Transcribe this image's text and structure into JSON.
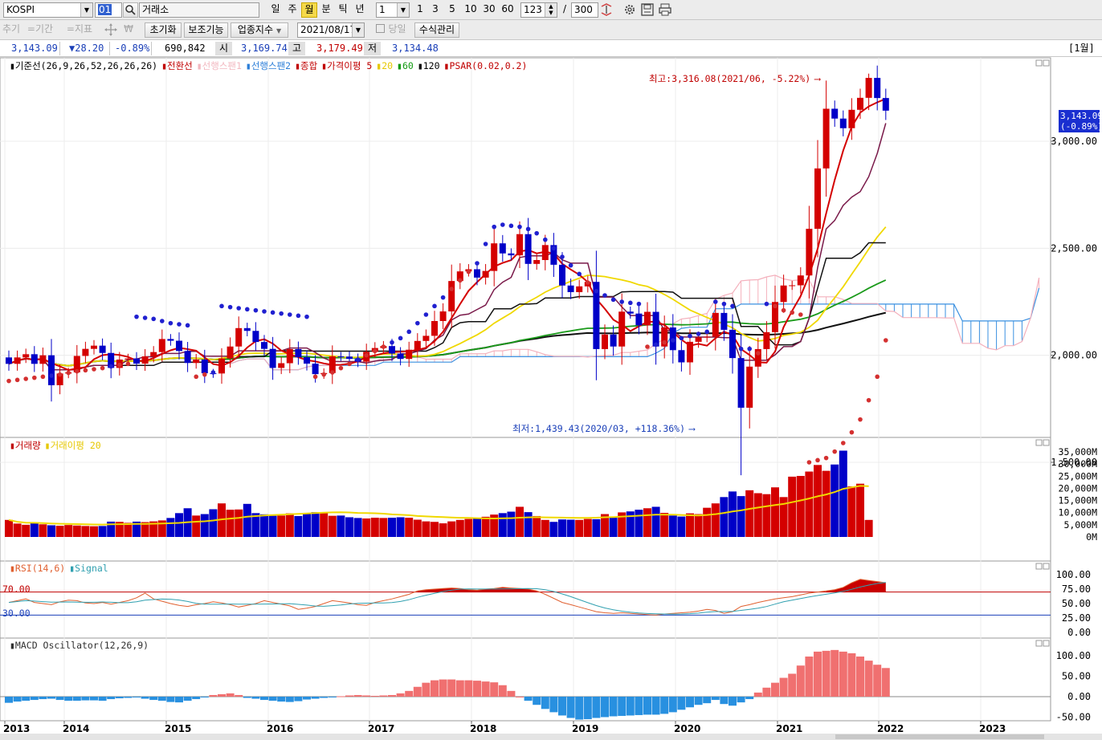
{
  "toolbar": {
    "symbol": "KOSPI",
    "code": "01",
    "exchange": "거래소",
    "periods": [
      "일",
      "주",
      "월",
      "분",
      "틱",
      "년"
    ],
    "active_period": "월",
    "multiplier": "1",
    "quick_nums": [
      "1",
      "3",
      "5",
      "10",
      "30",
      "60"
    ],
    "visible_bars": "123",
    "slash": "/",
    "total_bars": "300"
  },
  "toolbar2": {
    "disabled": [
      "추기",
      "=기간",
      "=지표"
    ],
    "buttons": [
      "초기화",
      "보조기능",
      "업종지수"
    ],
    "date": "2021/08/17",
    "today_label": "당일",
    "formula_button": "수식관리"
  },
  "quote": {
    "price": "3,143.09",
    "change": "▼28.20",
    "change_pct": "-0.89%",
    "volume": "690,842",
    "open_label": "시",
    "open": "3,169.74",
    "high_label": "고",
    "high": "3,179.49",
    "low_label": "저",
    "low": "3,134.48",
    "right_label": "[1월]"
  },
  "legends": {
    "price": [
      {
        "text": "기준선(26,9,26,52,26,26,26)",
        "color": "#000000"
      },
      {
        "text": "전환선",
        "color": "#c00000"
      },
      {
        "text": "선행스팬1",
        "color": "#f2b8c0"
      },
      {
        "text": "선행스팬2",
        "color": "#2d7fd8"
      },
      {
        "text": "종합",
        "color": "#c00000"
      },
      {
        "text": "가격이평 5",
        "color": "#c00000"
      },
      {
        "text": "20",
        "color": "#e6c800"
      },
      {
        "text": "60",
        "color": "#129a12"
      },
      {
        "text": "120",
        "color": "#000000"
      },
      {
        "text": "PSAR(0.02,0.2)",
        "color": "#c00000"
      }
    ],
    "volume": [
      {
        "text": "거래량",
        "color": "#c00000"
      },
      {
        "text": "거래이평 20",
        "color": "#e6c800"
      }
    ],
    "rsi": [
      {
        "text": "RSI(14,6)",
        "color": "#e06030"
      },
      {
        "text": "Signal",
        "color": "#30a0b0"
      }
    ],
    "macd": [
      {
        "text": "MACD Oscillator(12,26,9)",
        "color": "#303030"
      }
    ]
  },
  "annotations": {
    "high": "최고:3,316.08(2021/06, -5.22%)",
    "low": "최저:1,439.43(2020/03, +118.36%)",
    "last_price": "3,143.09",
    "last_pct": "(-0.89%)",
    "rsi_upper": "70.00",
    "rsi_lower": "30.00"
  },
  "axes": {
    "price": [
      "3,000.00",
      "2,500.00",
      "2,000.00",
      "1,500.00"
    ],
    "volume": [
      "35,000M",
      "30,000M",
      "25,000M",
      "20,000M",
      "15,000M",
      "10,000M",
      "5,000M",
      "0M"
    ],
    "rsi": [
      "100.00",
      "75.00",
      "50.00",
      "25.00",
      "0.00"
    ],
    "macd": [
      "100.00",
      "50.00",
      "0.00",
      "-50.00"
    ],
    "years": [
      "2013",
      "2014",
      "2015",
      "2016",
      "2017",
      "2018",
      "2019",
      "2020",
      "2021",
      "2022",
      "2023"
    ]
  },
  "colors": {
    "up": "#d40000",
    "down": "#0000c8",
    "ma5": "#d40000",
    "ma20": "#f0d800",
    "ma60": "#1a9a1a",
    "ma120": "#101010",
    "psar_up": "#d43030",
    "psar_down": "#2020d0",
    "tenkan": "#7a1a4a",
    "kijun": "#101010",
    "span1": "#f4b0bc",
    "span2": "#3a90e0",
    "macd_pos": "#f07070",
    "macd_neg": "#2890e0"
  },
  "chart_data": {
    "type": "candlestick",
    "price_range": [
      1400,
      3400
    ],
    "months": 104,
    "start": "2013-01",
    "latest_close": 3143.09,
    "high_point": {
      "value": 3316.08,
      "date": "2021/06"
    },
    "low_point": {
      "value": 1439.43,
      "date": "2020/03"
    },
    "closes": [
      1960,
      1990,
      2005,
      1960,
      2000,
      1860,
      1915,
      1920,
      1997,
      2030,
      2045,
      2011,
      1941,
      1980,
      1985,
      1961,
      1995,
      2015,
      2076,
      2068,
      2020,
      1964,
      1980,
      1916,
      1915,
      1985,
      2041,
      2127,
      2114,
      2062,
      2030,
      1941,
      1963,
      2029,
      1991,
      1961,
      1912,
      1917,
      1995,
      1994,
      1983,
      1970,
      2016,
      2034,
      2043,
      2008,
      1983,
      2026,
      2067,
      2091,
      2160,
      2205,
      2347,
      2392,
      2402,
      2363,
      2394,
      2523,
      2476,
      2467,
      2566,
      2427,
      2445,
      2515,
      2423,
      2326,
      2295,
      2322,
      2343,
      2029,
      2097,
      2041,
      2204,
      2195,
      2140,
      2203,
      2041,
      2130,
      2024,
      1967,
      2063,
      2083,
      2087,
      2198,
      2119,
      1987,
      1755,
      1947,
      2029,
      2108,
      2249,
      2326,
      2327,
      2373,
      2591,
      2873,
      3152,
      3106,
      3061,
      3147,
      3203,
      3296,
      3202,
      3143
    ],
    "volume_billion_won": [
      7000,
      5500,
      5000,
      5800,
      5200,
      4800,
      4600,
      4900,
      4700,
      4500,
      4400,
      4500,
      6300,
      6200,
      5800,
      6300,
      6100,
      6400,
      6800,
      7800,
      9800,
      11800,
      8800,
      9400,
      11400,
      13800,
      11200,
      11300,
      13600,
      9800,
      9300,
      8700,
      8800,
      9700,
      8600,
      9800,
      10200,
      9800,
      8700,
      8800,
      8100,
      7800,
      7600,
      7900,
      7800,
      7900,
      8100,
      7900,
      7100,
      6400,
      6200,
      5600,
      6400,
      7000,
      7400,
      7600,
      8300,
      9200,
      9800,
      10400,
      12400,
      10200,
      8600,
      7000,
      6200,
      7200,
      7100,
      7000,
      7400,
      7300,
      9400,
      7900,
      10100,
      10500,
      11200,
      11800,
      12400,
      9900,
      8800,
      8400,
      9700,
      9400,
      12000,
      13800,
      16400,
      18700,
      16800,
      19200,
      18000,
      17600,
      20400,
      16400,
      24800,
      25100,
      26900,
      29600,
      27200,
      29800,
      35500,
      20800,
      21900,
      7000
    ],
    "psar": [
      1880,
      1885,
      1890,
      1895,
      1900,
      1905,
      1910,
      1918,
      1925,
      1930,
      1935,
      1940,
      1948,
      1955,
      1960,
      2180,
      2175,
      2170,
      2160,
      2150,
      2145,
      2140,
      1900,
      1910,
      1920,
      2230,
      2225,
      2220,
      2215,
      2210,
      2205,
      2200,
      2195,
      2190,
      2185,
      2180,
      1900,
      1910,
      1920,
      1940,
      1960,
      1980,
      2000,
      2020,
      2040,
      2060,
      2080,
      2110,
      2150,
      2190,
      2230,
      2270,
      2310,
      2350,
      2390,
      2430,
      2520,
      2600,
      2610,
      2605,
      2600,
      2590,
      2570,
      2540,
      2500,
      2460,
      2420,
      2380,
      2340,
      2300,
      2280,
      2260,
      2250,
      2245,
      2240,
      2040,
      2050,
      2060,
      2070,
      2080,
      2090,
      2100,
      2110,
      2250,
      2240,
      2230,
      2030,
      2030,
      2010,
      2240,
      2230,
      2210,
      2200,
      2190,
      1500,
      1510,
      1520,
      1550,
      1590,
      1640,
      1700,
      1790,
      1900,
      2070
    ],
    "rsi": [
      52,
      55,
      58,
      52,
      50,
      48,
      53,
      56,
      55,
      51,
      50,
      52,
      49,
      52,
      55,
      60,
      68,
      58,
      54,
      50,
      47,
      45,
      48,
      50,
      53,
      51,
      48,
      44,
      47,
      50,
      55,
      52,
      49,
      46,
      40,
      42,
      45,
      50,
      55,
      53,
      51,
      48,
      47,
      52,
      55,
      58,
      62,
      66,
      72,
      74,
      75,
      76,
      77,
      76,
      74,
      73,
      75,
      76,
      78,
      77,
      76,
      75,
      72,
      66,
      59,
      52,
      48,
      44,
      40,
      36,
      34,
      33,
      34,
      33,
      32,
      31,
      30,
      32,
      33,
      34,
      35,
      37,
      40,
      38,
      33,
      36,
      45,
      48,
      52,
      55,
      58,
      60,
      62,
      65,
      68,
      70,
      72,
      74,
      78,
      86,
      92,
      90,
      88,
      86
    ],
    "macd": [
      -15,
      -12,
      -10,
      -8,
      -6,
      -5,
      -8,
      -10,
      -10,
      -9,
      -9,
      -10,
      -6,
      -4,
      -3,
      -2,
      -5,
      -8,
      -10,
      -13,
      -14,
      -10,
      -6,
      -2,
      4,
      6,
      8,
      4,
      -3,
      -5,
      -8,
      -10,
      -12,
      -13,
      -11,
      -7,
      -5,
      -3,
      -1,
      1,
      3,
      4,
      3,
      2,
      3,
      4,
      8,
      14,
      24,
      34,
      40,
      42,
      42,
      40,
      40,
      39,
      37,
      35,
      28,
      14,
      0,
      -10,
      -20,
      -30,
      -38,
      -46,
      -52,
      -56,
      -55,
      -52,
      -50,
      -48,
      -47,
      -46,
      -45,
      -44,
      -44,
      -42,
      -38,
      -32,
      -26,
      -20,
      -16,
      -8,
      -18,
      -22,
      -14,
      -6,
      10,
      22,
      34,
      46,
      56,
      76,
      98,
      110,
      112,
      114,
      110,
      106,
      98,
      88,
      78,
      70
    ]
  }
}
